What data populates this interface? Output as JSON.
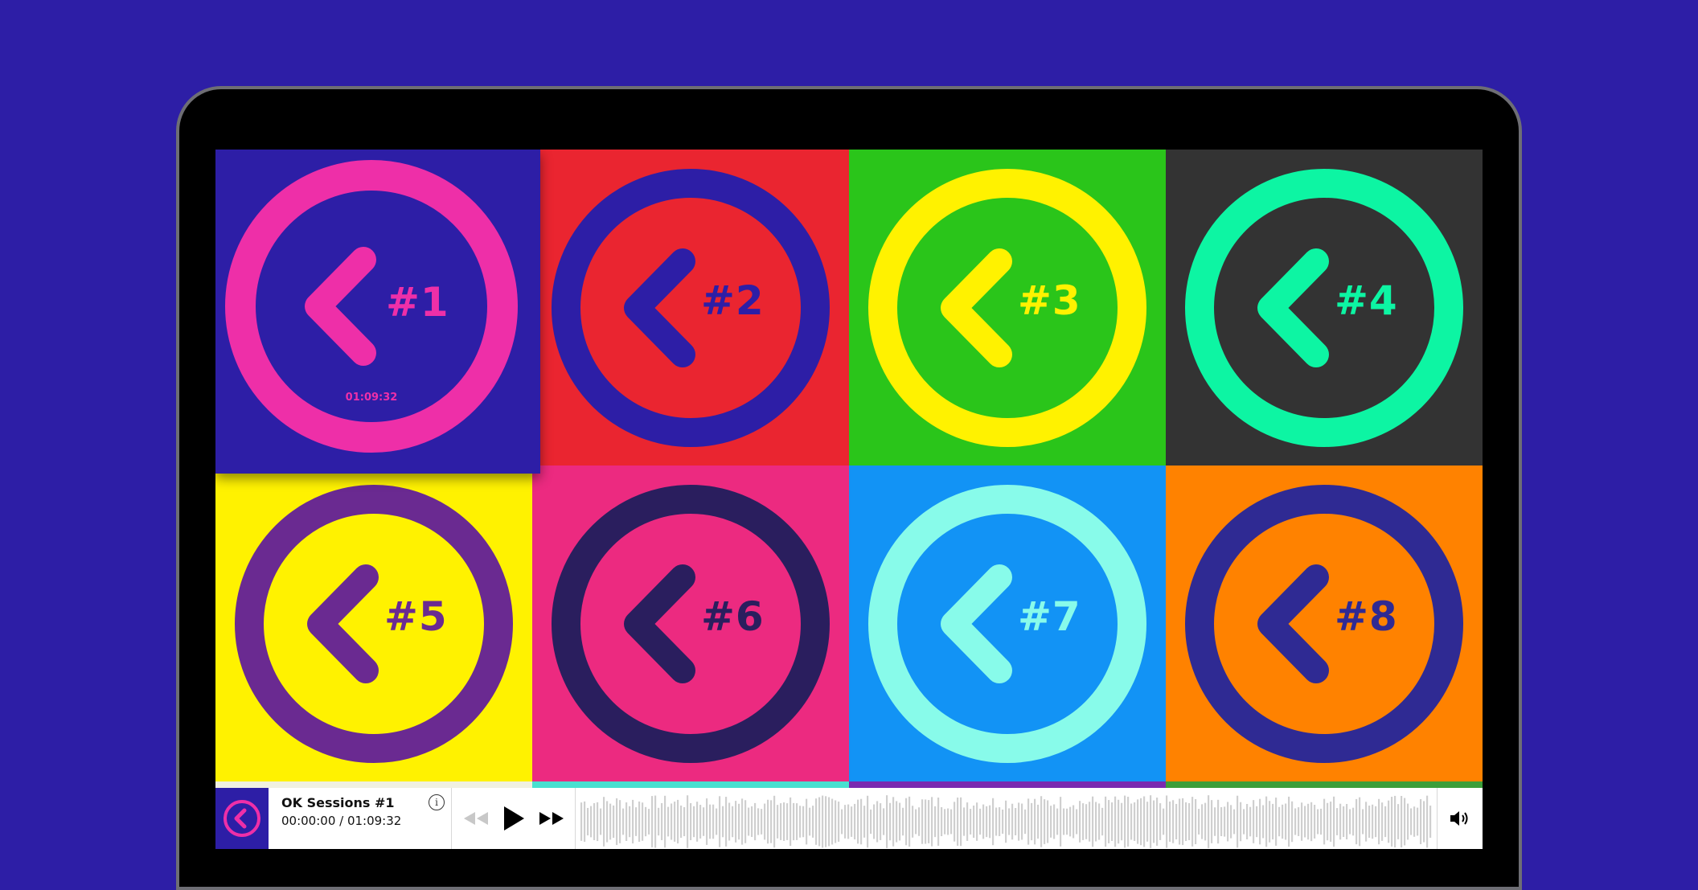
{
  "tiles": [
    {
      "label": "#1",
      "bg": "#2d1ea6",
      "fg": "#ee2fa8",
      "duration": "01:09:32",
      "selected": true
    },
    {
      "label": "#2",
      "bg": "#ea2530",
      "fg": "#2d1ea6"
    },
    {
      "label": "#3",
      "bg": "#2ac51a",
      "fg": "#fff200"
    },
    {
      "label": "#4",
      "bg": "#333333",
      "fg": "#0df5a3"
    },
    {
      "label": "#5",
      "bg": "#fff200",
      "fg": "#6a2a91"
    },
    {
      "label": "#6",
      "bg": "#ec2a80",
      "fg": "#2a1e5e"
    },
    {
      "label": "#7",
      "bg": "#1293f5",
      "fg": "#88fbea"
    },
    {
      "label": "#8",
      "bg": "#ff8200",
      "fg": "#2f2a93"
    }
  ],
  "strips": [
    "#f0f0e0",
    "#48e0d0",
    "#7a2ab0",
    "#3c9e3a"
  ],
  "player": {
    "title": "OK Sessions #1",
    "time": "00:00:00 / 01:09:32",
    "info_icon": "i",
    "accent": "#ee2fa8"
  }
}
